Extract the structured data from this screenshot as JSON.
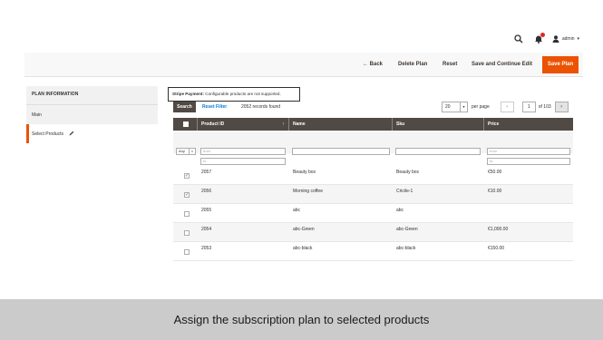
{
  "header": {
    "user_name": "admin",
    "notification_count_badge": "",
    "icons": [
      "search-icon",
      "bell-icon",
      "user-icon",
      "chevron-down-icon"
    ]
  },
  "page_actions": {
    "back": "← Back",
    "delete": "Delete Plan",
    "reset": "Reset",
    "save_continue": "Save and Continue Edit",
    "save_plan": "Save Plan"
  },
  "sidebar": {
    "title": "PLAN INFORMATION",
    "items": [
      {
        "label": "Main"
      },
      {
        "label": "Select Products"
      }
    ]
  },
  "notice": {
    "bold": "Stripe Payment:",
    "text": " Configurable products are not supported."
  },
  "grid_controls": {
    "search": "Search",
    "reset_filter": "Reset Filter",
    "records": "2052 records found",
    "per_page_value": "20",
    "per_page_label": "per page",
    "current_page": "1",
    "of_pages": "of 103"
  },
  "table": {
    "columns": [
      "",
      "Product ID",
      "Name",
      "Sku",
      "Price"
    ],
    "filters": {
      "any": "Any",
      "from": "from",
      "to": "to"
    },
    "rows": [
      {
        "checked": true,
        "id": "2057",
        "name": "Beauty box",
        "sku": "Beauty box",
        "price": "€50.00"
      },
      {
        "checked": true,
        "id": "2056",
        "name": "Morning coffee",
        "sku": "Cricile-1",
        "price": "€10.00"
      },
      {
        "checked": false,
        "id": "2055",
        "name": "abc",
        "sku": "abc",
        "price": ""
      },
      {
        "checked": false,
        "id": "2054",
        "name": "abc-Green",
        "sku": "abc-Green",
        "price": "€1,000.00"
      },
      {
        "checked": false,
        "id": "2053",
        "name": "abc-black",
        "sku": "abc-black",
        "price": "€150.00"
      }
    ]
  },
  "caption": "Assign the subscription plan to selected products",
  "colors": {
    "accent": "#eb5202",
    "header_dark": "#514943",
    "link": "#007bdb"
  }
}
